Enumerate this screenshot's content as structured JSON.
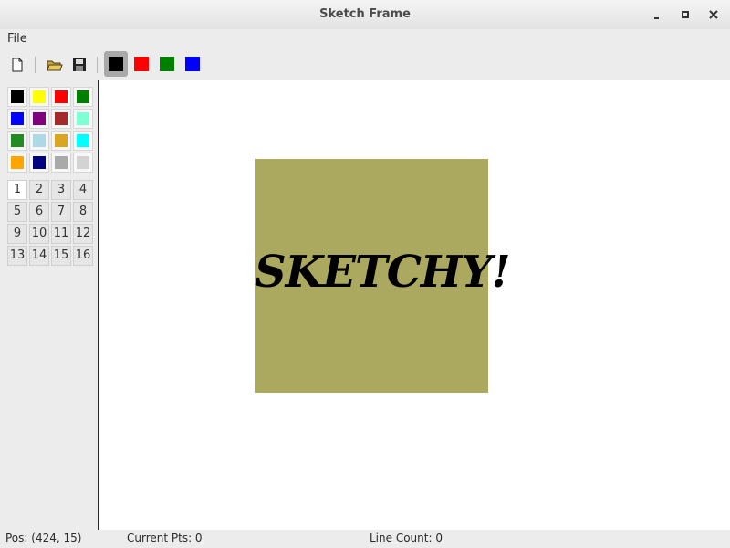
{
  "window": {
    "title": "Sketch Frame"
  },
  "menu": {
    "file": "File"
  },
  "toolbar": {
    "colors": [
      "#000000",
      "#ff0000",
      "#008000",
      "#0000ff"
    ],
    "active_color": "#000000"
  },
  "palette": {
    "colors": [
      "#000000",
      "#ffff00",
      "#ff0000",
      "#008000",
      "#0000ff",
      "#800080",
      "#a52a2a",
      "#7fffd4",
      "#228b22",
      "#add8e6",
      "#daa520",
      "#00ffff",
      "#ffa500",
      "#000080",
      "#a9a9a9",
      "#d3d3d3"
    ]
  },
  "widths": {
    "labels": [
      "1",
      "2",
      "3",
      "4",
      "5",
      "6",
      "7",
      "8",
      "9",
      "10",
      "11",
      "12",
      "13",
      "14",
      "15",
      "16"
    ],
    "selected": "1"
  },
  "canvas": {
    "shape_fill": "#aba95f",
    "text": "SKETCHY!"
  },
  "status": {
    "pos": "Pos: (424, 15)",
    "current_pts": "Current Pts: 0",
    "line_count": "Line Count: 0"
  }
}
